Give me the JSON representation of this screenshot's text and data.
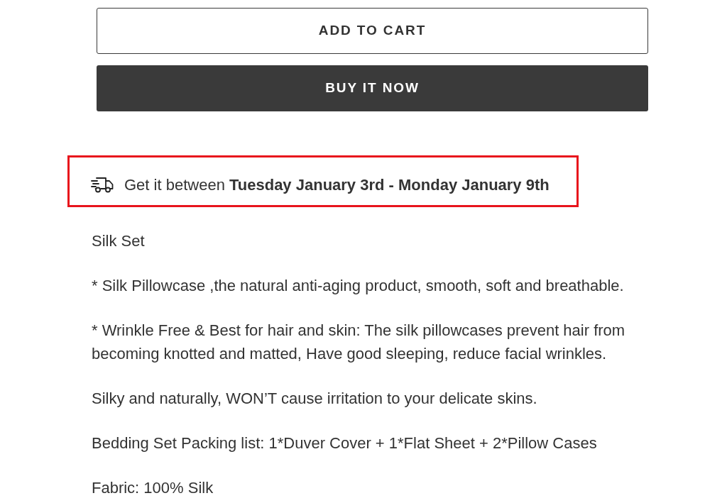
{
  "buttons": [
    {
      "kind": "outline",
      "label": "ADD TO CART"
    },
    {
      "kind": "solid",
      "label": "BUY IT NOW"
    }
  ],
  "delivery": {
    "highlighted": true,
    "text": "Get it between **Tuesday January 3rd - Monday January 9th**"
  },
  "description": [
    "Silk Set",
    "* Silk Pillowcase ,the natural anti-aging product, smooth, soft and breathable.",
    "* Wrinkle Free & Best for hair and skin: The silk pillowcases prevent hair from becoming knotted and matted, Have good sleeping, reduce facial wrinkles.",
    "Silky and naturally, WON’T cause irritation to your delicate skins.",
    "Bedding Set Packing list: 1*Duver Cover + 1*Flat Sheet + 2*Pillow Cases",
    "Fabric: 100% Silk"
  ]
}
